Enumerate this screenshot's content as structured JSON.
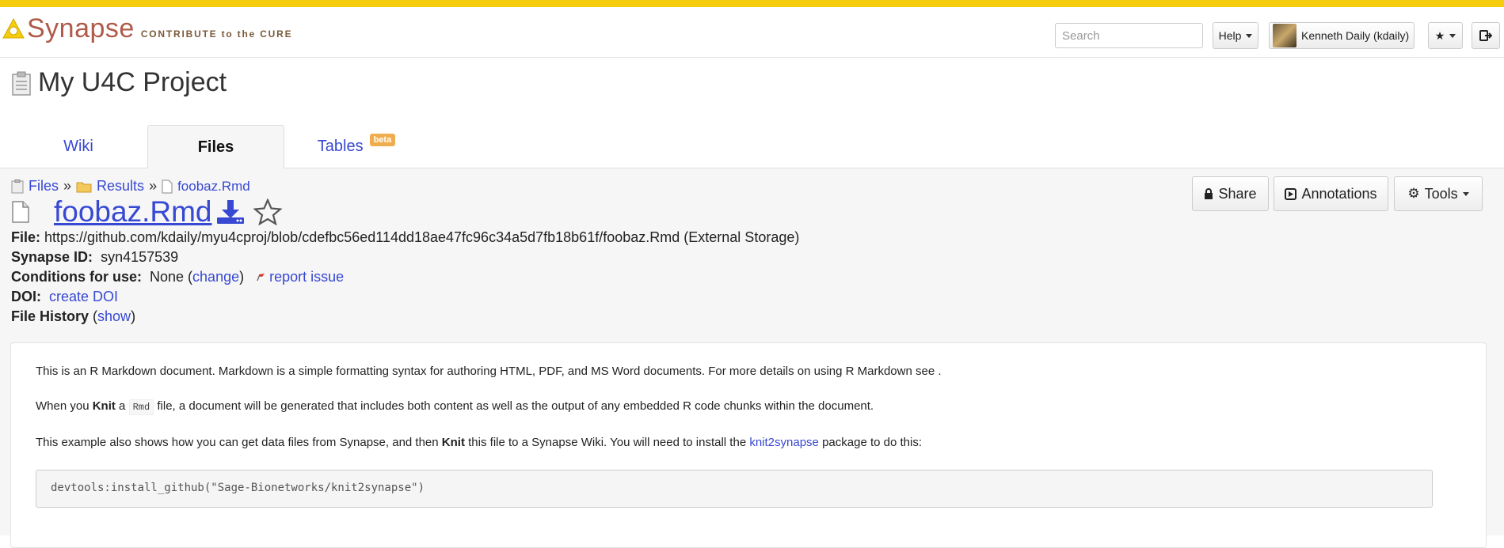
{
  "header": {
    "logo_text": "Synapse",
    "tagline": "CONTRIBUTE to the CURE",
    "search_placeholder": "Search",
    "help_label": "Help",
    "user_label": "Kenneth Daily (kdaily)"
  },
  "project": {
    "title": "My U4C Project"
  },
  "tabs": [
    {
      "label": "Wiki"
    },
    {
      "label": "Files"
    },
    {
      "label": "Tables",
      "badge": "beta"
    }
  ],
  "breadcrumb": [
    {
      "label": "Files"
    },
    {
      "label": "Results"
    },
    {
      "label": "foobaz.Rmd"
    }
  ],
  "breadcrumb_sep": "»",
  "file": {
    "name": "foobaz.Rmd",
    "file_label": "File:",
    "file_url": "https://github.com/kdaily/myu4cproj/blob/cdefbc56ed114dd18ae47fc96c34a5d7fb18b61f/foobaz.Rmd",
    "storage_note": "(External Storage)",
    "synapse_id_label": "Synapse ID:",
    "synapse_id": "syn4157539",
    "conditions_label": "Conditions for use:",
    "conditions_value": "None",
    "change_link": "change",
    "report_issue": "report issue",
    "doi_label": "DOI:",
    "doi_link": "create DOI",
    "history_label": "File History",
    "history_link": "show"
  },
  "actions": {
    "share": "Share",
    "annotations": "Annotations",
    "tools": "Tools"
  },
  "wiki": {
    "p1": "This is an R Markdown document. Markdown is a simple formatting syntax for authoring HTML, PDF, and MS Word documents. For more details on using R Markdown see .",
    "p2_a": "When you ",
    "p2_bold": "Knit",
    "p2_b": " a ",
    "p2_code": "Rmd",
    "p2_c": " file, a document will be generated that includes both content as well as the output of any embedded R code chunks within the document.",
    "p3_a": "This example also shows how you can get data files from Synapse, and then ",
    "p3_bold": "Knit",
    "p3_b": " this file to a Synapse Wiki. You will need to install the ",
    "p3_link": "knit2synapse",
    "p3_c": " package to do this:",
    "code": "devtools:install_github(\"Sage-Bionetworks/knit2synapse\")"
  },
  "colors": {
    "accent_yellow": "#f5cd0c",
    "link_blue": "#3748d2",
    "beta_orange": "#f0ad4e"
  }
}
